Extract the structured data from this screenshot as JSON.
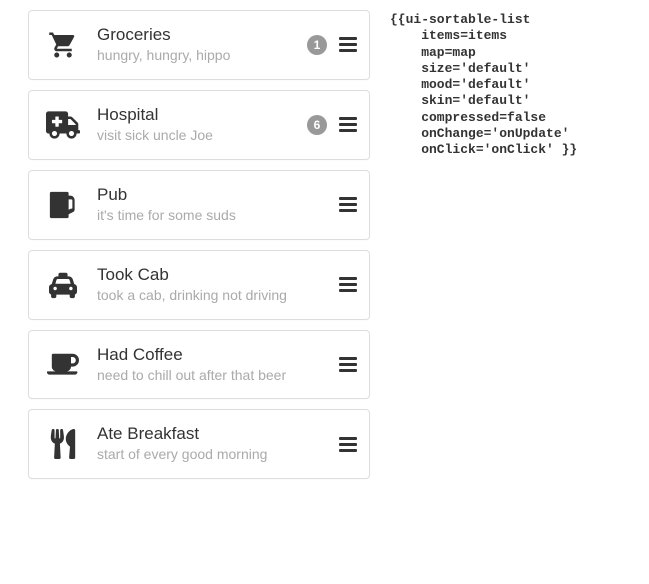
{
  "list": {
    "items": [
      {
        "icon": "cart",
        "title": "Groceries",
        "subtitle": "hungry, hungry, hippo",
        "badge": "1"
      },
      {
        "icon": "ambulance",
        "title": "Hospital",
        "subtitle": "visit sick uncle Joe",
        "badge": "6"
      },
      {
        "icon": "beer",
        "title": "Pub",
        "subtitle": "it's time for some suds",
        "badge": null
      },
      {
        "icon": "taxi",
        "title": "Took Cab",
        "subtitle": "took a cab, drinking not driving",
        "badge": null
      },
      {
        "icon": "coffee",
        "title": "Had Coffee",
        "subtitle": "need to chill out after that beer",
        "badge": null
      },
      {
        "icon": "utensils",
        "title": "Ate Breakfast",
        "subtitle": "start of every good morning",
        "badge": null
      }
    ]
  },
  "code": {
    "text": "{{ui-sortable-list\n    items=items\n    map=map\n    size='default'\n    mood='default'\n    skin='default'\n    compressed=false\n    onChange='onUpdate'\n    onClick='onClick' }}"
  }
}
